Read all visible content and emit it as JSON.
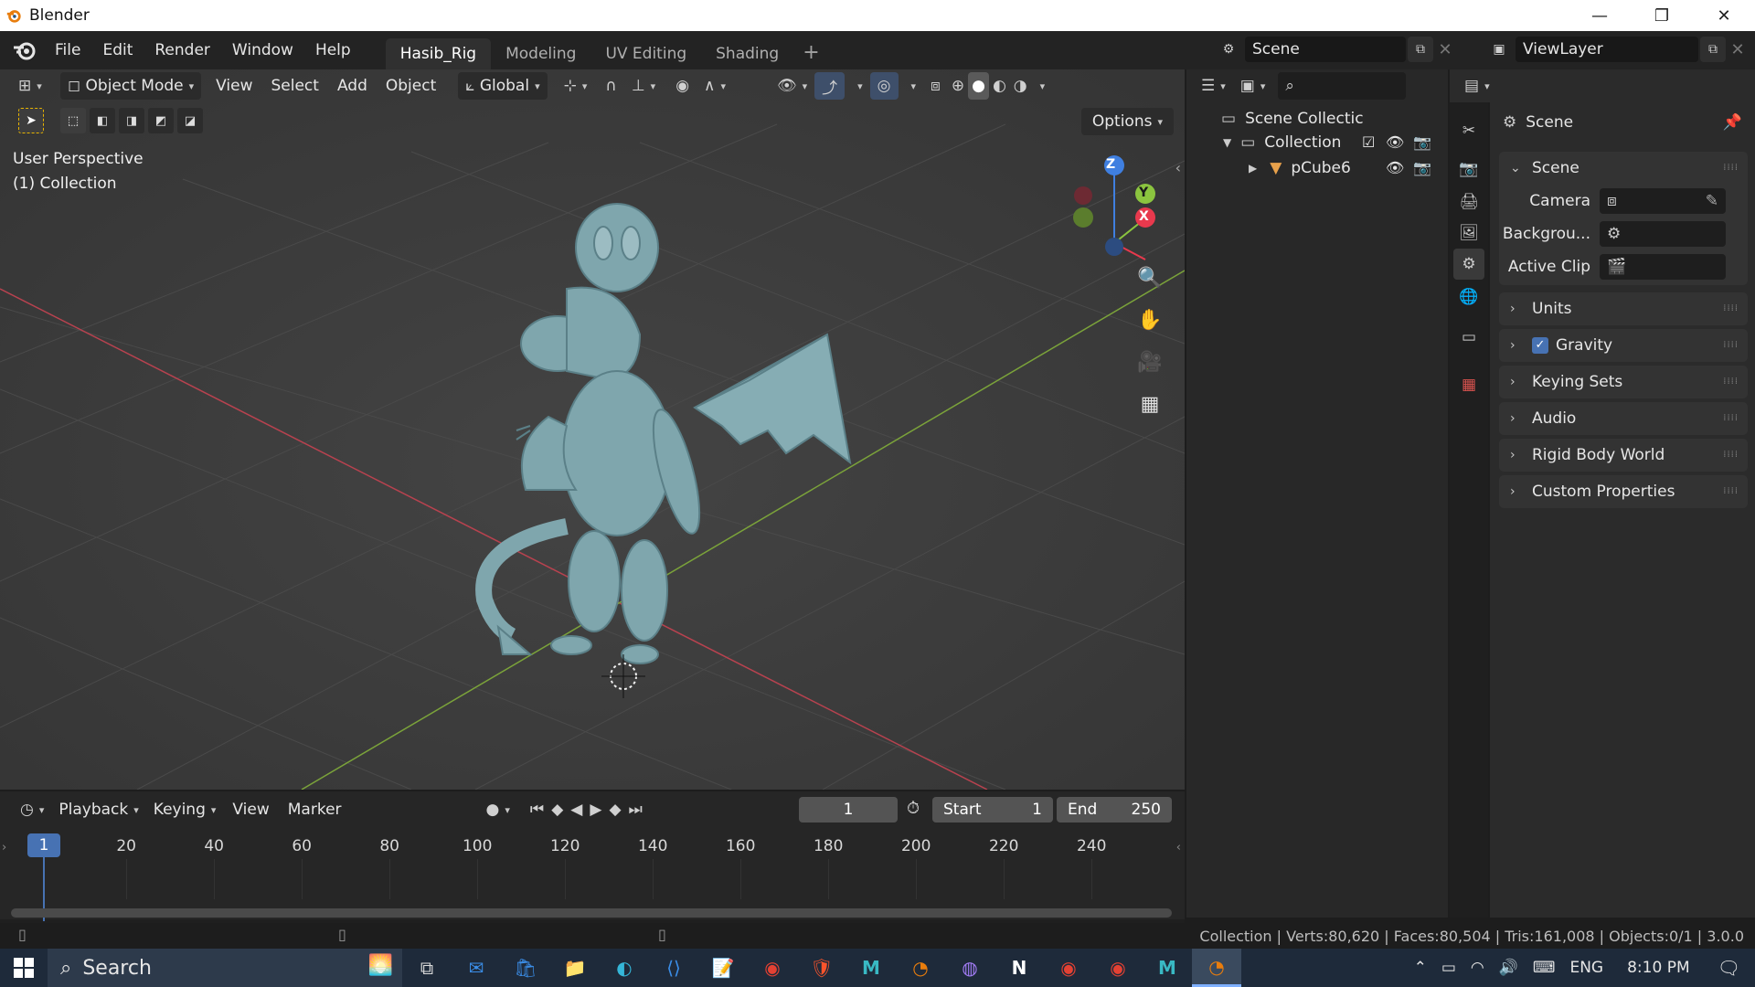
{
  "window": {
    "title": "Blender",
    "minimize_icon": "minimize-icon",
    "maximize_icon": "restore-icon",
    "close_icon": "close-icon"
  },
  "menubar": {
    "items": [
      "File",
      "Edit",
      "Render",
      "Window",
      "Help"
    ],
    "workspaces": [
      "Hasib_Rig",
      "Modeling",
      "UV Editing",
      "Shading"
    ],
    "active_workspace": "Hasib_Rig",
    "scene": "Scene",
    "view_layer": "ViewLayer"
  },
  "viewport": {
    "mode": "Object Mode",
    "menus": [
      "View",
      "Select",
      "Add",
      "Object"
    ],
    "transform_orientation": "Global",
    "options_label": "Options",
    "perspective_label": "User Perspective",
    "collection_label": "(1) Collection",
    "gizmo_axes": {
      "x": "X",
      "y": "Y",
      "z": "Z"
    },
    "colors": {
      "x_axis": "#e8394d",
      "y_axis": "#8bc43f",
      "z_axis": "#3f7fe0",
      "floor": "#3c3c3c",
      "model": "#7fa6ad"
    }
  },
  "timeline": {
    "menus": [
      "Playback",
      "Keying",
      "View",
      "Marker"
    ],
    "current_frame": "1",
    "start_label": "Start",
    "start_value": "1",
    "end_label": "End",
    "end_value": "250",
    "ruler_ticks": [
      "20",
      "40",
      "60",
      "80",
      "100",
      "120",
      "140",
      "160",
      "180",
      "200",
      "220",
      "240"
    ]
  },
  "outliner": {
    "root": "Scene Collectic",
    "collection": "Collection",
    "object": "pCube6"
  },
  "properties": {
    "context_title": "Scene",
    "scene_panel": {
      "title": "Scene",
      "rows": [
        {
          "label": "Camera"
        },
        {
          "label": "Backgrou..."
        },
        {
          "label": "Active Clip"
        }
      ]
    },
    "collapsed_panels": [
      "Units",
      "Gravity",
      "Keying Sets",
      "Audio",
      "Rigid Body World",
      "Custom Properties"
    ],
    "gravity_checked": true
  },
  "status": {
    "text": "Collection | Verts:80,620 | Faces:80,504 | Tris:161,008 | Objects:0/1 | 3.0.0"
  },
  "taskbar": {
    "search_placeholder": "Search",
    "language": "ENG",
    "time": "8:10 PM",
    "apps": [
      "task-view-icon",
      "mail-icon",
      "store-icon",
      "file-explorer-icon",
      "edge-icon",
      "vscode-icon",
      "notepad-icon",
      "chrome-icon",
      "brave-icon",
      "maya-icon",
      "blender-icon",
      "github-icon",
      "notion-icon",
      "chrome-icon",
      "chrome-icon",
      "maya-icon",
      "blender-icon"
    ]
  }
}
